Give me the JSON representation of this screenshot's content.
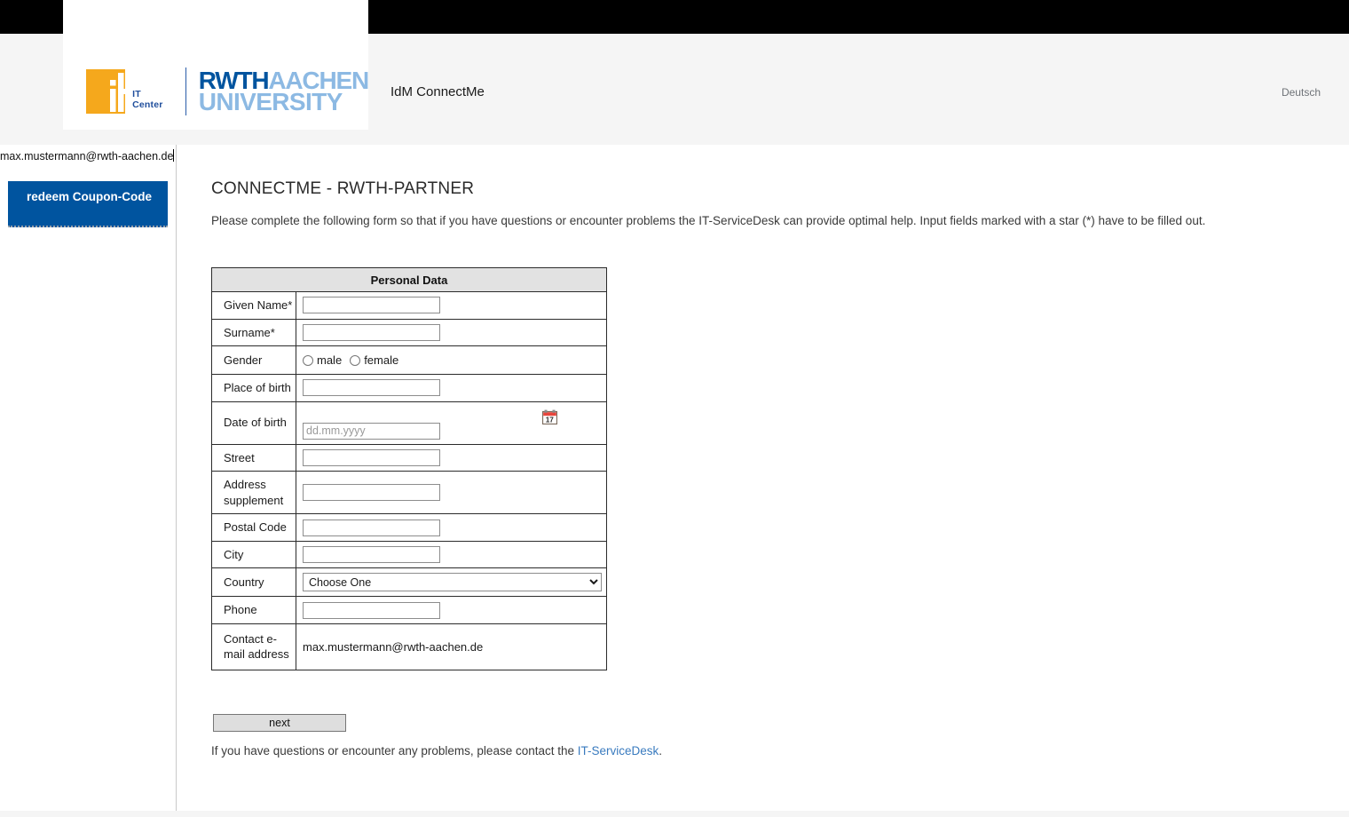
{
  "header": {
    "app_title": "IdM ConnectMe",
    "language_link": "Deutsch",
    "logo": {
      "it_center_label": "IT Center",
      "rwth_bold": "RWTH",
      "rwth_light_1": "AACHEN",
      "rwth_light_2": "UNIVERSITY"
    },
    "colors": {
      "band": "#000000",
      "strip_bg": "#f5f5f5",
      "it_orange": "#f5a81c",
      "rwth_blue": "#00549f",
      "rwth_light_blue": "#8cb9e3"
    }
  },
  "sidebar": {
    "email_echo": "max.mustermann@rwth-aachen.de",
    "coupon_button_label": "redeem Coupon-Code",
    "coupon_button_color": "#00549f"
  },
  "main": {
    "page_title": "CONNECTME - RWTH-PARTNER",
    "intro": "Please complete the following form so that if you have questions or encounter problems the IT-ServiceDesk can provide optimal help. Input fields marked with a star (*) have to be filled out.",
    "next_button_label": "next",
    "footer": {
      "text_before": "If you have questions or encounter any problems, please contact the ",
      "link_text": "IT-ServiceDesk",
      "text_after": ".",
      "link_color": "#3a7bbf"
    }
  },
  "form": {
    "caption": "Personal Data",
    "rows": {
      "given_name": {
        "label": "Given Name*",
        "value": "",
        "placeholder": ""
      },
      "surname": {
        "label": "Surname*",
        "value": "",
        "placeholder": ""
      },
      "gender": {
        "label": "Gender",
        "option_male": "male",
        "option_female": "female",
        "selected": ""
      },
      "place_of_birth": {
        "label": "Place of birth",
        "value": "",
        "placeholder": ""
      },
      "date_of_birth": {
        "label": "Date of birth",
        "value": "",
        "placeholder": "dd.mm.yyyy",
        "icon": "calendar-icon",
        "icon_day": "17"
      },
      "street": {
        "label": "Street",
        "value": "",
        "placeholder": ""
      },
      "address_supplement": {
        "label": "Address supplement",
        "value": "",
        "placeholder": ""
      },
      "postal_code": {
        "label": "Postal Code",
        "value": "",
        "placeholder": ""
      },
      "city": {
        "label": "City",
        "value": "",
        "placeholder": ""
      },
      "country": {
        "label": "Country",
        "selected_option": "Choose One"
      },
      "phone": {
        "label": "Phone",
        "value": "",
        "placeholder": ""
      },
      "contact_email": {
        "label": "Contact e-mail address",
        "value": "max.mustermann@rwth-aachen.de"
      }
    }
  }
}
